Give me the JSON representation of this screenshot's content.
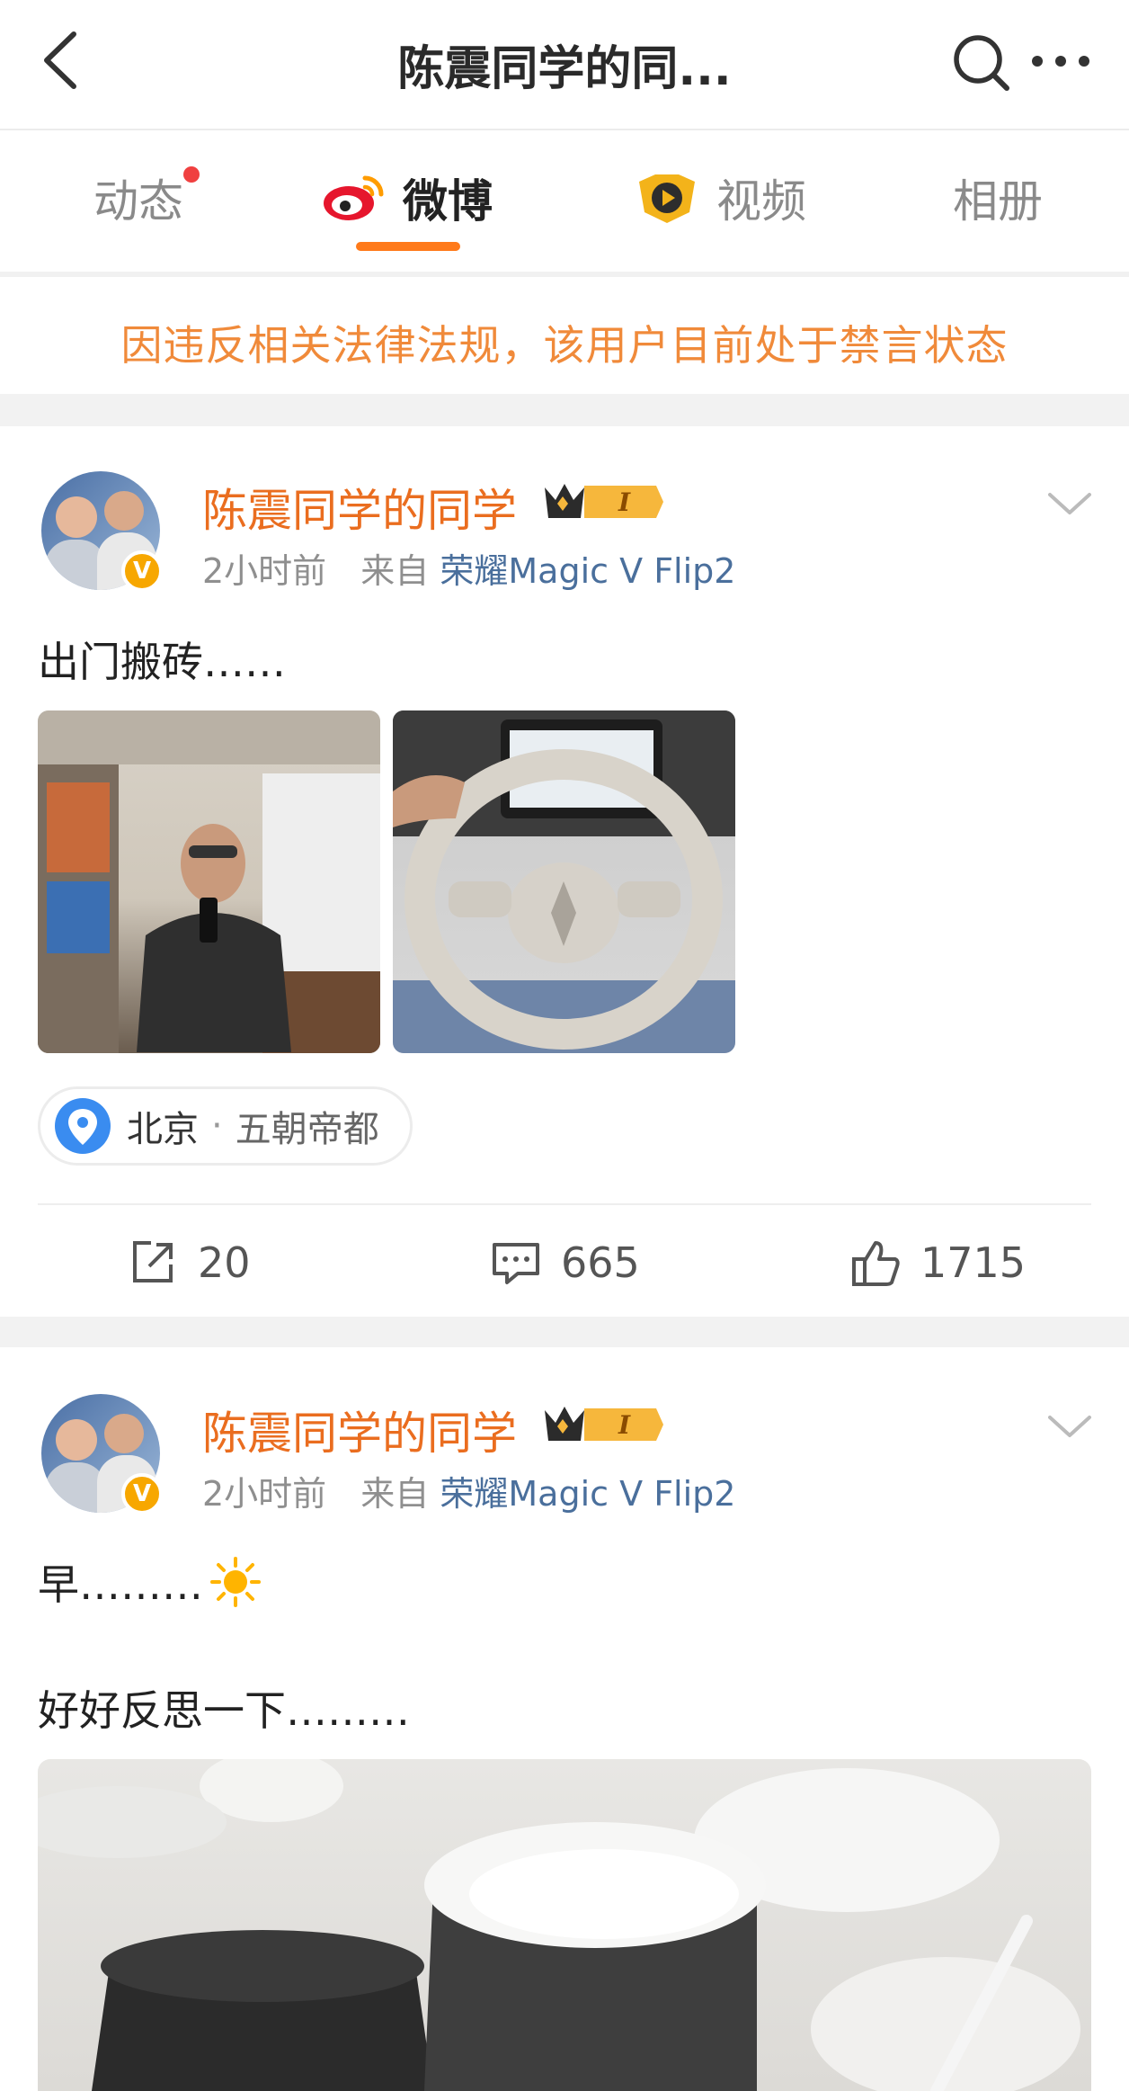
{
  "header": {
    "title": "陈震同学的同...",
    "icons": [
      "back-arrow-icon",
      "search-icon",
      "more-icon"
    ]
  },
  "tabs": [
    {
      "label": "动态",
      "has_dot": true
    },
    {
      "label": "微博",
      "active": true,
      "icon": "weibo-logo-icon"
    },
    {
      "label": "视频",
      "icon": "video-play-icon"
    },
    {
      "label": "相册"
    }
  ],
  "notice": {
    "text": "因违反相关法律法规，该用户目前处于禁言状态"
  },
  "posts": [
    {
      "author": "陈震同学的同学",
      "badge": "I",
      "time": "2小时前",
      "from_label": "来自",
      "source": "荣耀Magic V Flip2",
      "text": "出门搬砖……",
      "location": {
        "city": "北京",
        "sep": "·",
        "place": "五朝帝都"
      },
      "stats": {
        "repost": "20",
        "comment": "665",
        "like": "1715"
      }
    },
    {
      "author": "陈震同学的同学",
      "badge": "I",
      "time": "2小时前",
      "from_label": "来自",
      "source": "荣耀Magic V Flip2",
      "text_line1": "早………",
      "text_line2": "好好反思一下………"
    }
  ],
  "colors": {
    "accent": "#ff7a1a",
    "name": "#ea6d1f",
    "notice": "#f08a3a",
    "source_link": "#4a6f9c"
  }
}
